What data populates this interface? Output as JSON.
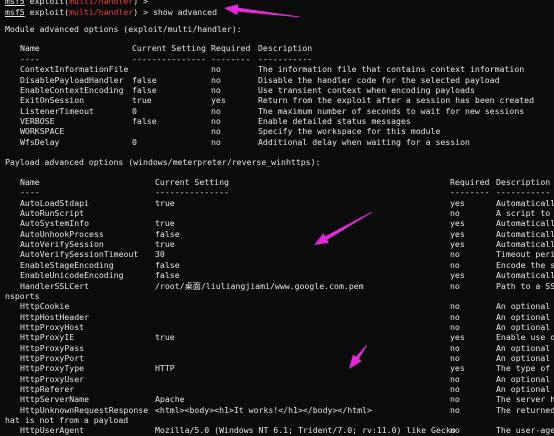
{
  "prompt": {
    "msf": "msf5",
    "module_word": "exploit(",
    "module_name": "multi/handler",
    "module_close": ")",
    "gt": ">",
    "line0_cmd": "",
    "line1_cmd": "show advanced"
  },
  "module_section": {
    "title": "Module advanced options (exploit/multi/handler):",
    "headers": [
      "Name",
      "Current Setting",
      "Required",
      "Description"
    ],
    "dashes": [
      "----",
      "---------------",
      "--------",
      "-----------"
    ],
    "rows": [
      [
        "ContextInformationFile",
        "",
        "no",
        "The information file that contains context information"
      ],
      [
        "DisablePayloadHandler",
        "false",
        "no",
        "Disable the handler code for the selected payload"
      ],
      [
        "EnableContextEncoding",
        "false",
        "no",
        "Use transient context when encoding payloads"
      ],
      [
        "ExitOnSession",
        "true",
        "yes",
        "Return from the exploit after a session has been created"
      ],
      [
        "ListenerTimeout",
        "0",
        "no",
        "The maximum number of seconds to wait for new sessions"
      ],
      [
        "VERBOSE",
        "false",
        "no",
        "Enable detailed status messages"
      ],
      [
        "WORKSPACE",
        "",
        "no",
        "Specify the workspace for this module"
      ],
      [
        "WfsDelay",
        "0",
        "no",
        "Additional delay when waiting for a session"
      ]
    ]
  },
  "payload_section": {
    "title": "Payload advanced options (windows/meterpreter/reverse_winhttps):",
    "headers": [
      "Name",
      "Current Setting",
      "Required",
      "Description"
    ],
    "dashes": [
      "----",
      "---------------",
      "--------",
      "-----------"
    ],
    "rows": [
      [
        "AutoLoadStdapi",
        "true",
        "yes",
        "Automatically"
      ],
      [
        "AutoRunScript",
        "",
        "no",
        "A script to r"
      ],
      [
        "AutoSystemInfo",
        "true",
        "yes",
        "Automatically"
      ],
      [
        "AutoUnhookProcess",
        "false",
        "yes",
        "Automatically"
      ],
      [
        "AutoVerifySession",
        "true",
        "yes",
        "Automatically"
      ],
      [
        "AutoVerifySessionTimeout",
        "30",
        "no",
        "Timeout perio"
      ],
      [
        "EnableStageEncoding",
        "false",
        "no",
        "Encode the se"
      ],
      [
        "EnableUnicodeEncoding",
        "false",
        "yes",
        "Automatically"
      ],
      [
        "HandlerSSLCert",
        "/root/桌面/liuliangjiami/www.google.com.pem",
        "no",
        "Path to a SSL"
      ],
      [
        "__wrap__",
        "nsports"
      ],
      [
        "HttpCookie",
        "",
        "no",
        "An optional v"
      ],
      [
        "HttpHostHeader",
        "",
        "no",
        "An optional v"
      ],
      [
        "HttpProxyHost",
        "",
        "no",
        "An optional p"
      ],
      [
        "HttpProxyIE",
        "true",
        "yes",
        "Enable use of"
      ],
      [
        "HttpProxyPass",
        "",
        "no",
        "An optional p"
      ],
      [
        "HttpProxyPort",
        "",
        "no",
        "An optional p"
      ],
      [
        "HttpProxyType",
        "HTTP",
        "yes",
        "The type of p"
      ],
      [
        "HttpProxyUser",
        "",
        "no",
        "An optional p"
      ],
      [
        "HttpReferer",
        "",
        "no",
        "An optional v"
      ],
      [
        "HttpServerName",
        "Apache",
        "no",
        "The server he"
      ],
      [
        "HttpUnknownRequestResponse",
        "<html><body><h1>It works!</h1></body></html>",
        "no",
        "The returned"
      ],
      [
        "__wrap__",
        "hat is not from a payload"
      ],
      [
        "HttpUserAgent",
        "Mozilla/5.0 (Windows NT 6.1; Trident/7.0; rv:11.0) like Gecko",
        "no",
        "The user-agen"
      ]
    ]
  },
  "colors": {
    "background": "#0b0b0b",
    "text": "#e6e6e6",
    "prompt_red": "#e83a3a",
    "annotation_arrow": "#e22ad9"
  }
}
